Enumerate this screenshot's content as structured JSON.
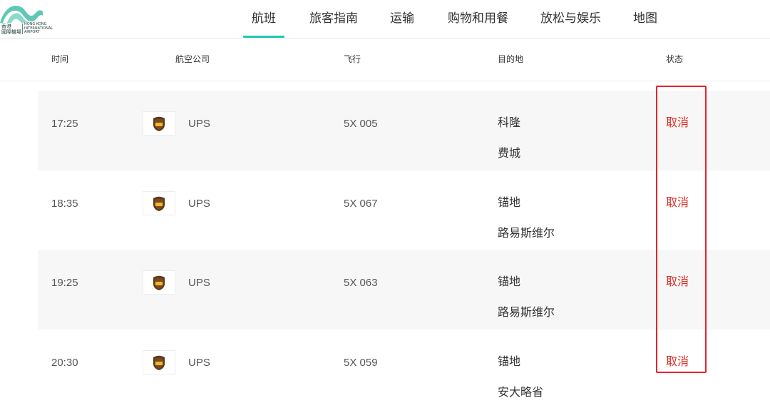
{
  "logo": {
    "zh_line1": "香港",
    "zh_line2": "國際機場",
    "en_line1": "HONG KONG",
    "en_line2": "INTERNATIONAL",
    "en_line3": "AIRPORT",
    "brand_color": "#5fc8b5"
  },
  "nav": {
    "items": [
      {
        "label": "航班",
        "active": true
      },
      {
        "label": "旅客指南",
        "active": false
      },
      {
        "label": "运输",
        "active": false
      },
      {
        "label": "购物和用餐",
        "active": false
      },
      {
        "label": "放松与娱乐",
        "active": false
      },
      {
        "label": "地图",
        "active": false
      }
    ],
    "active_color": "#1fc6b3"
  },
  "table": {
    "headers": {
      "time": "时间",
      "airline": "航空公司",
      "flight": "飞行",
      "destination": "目的地",
      "status": "状态"
    },
    "rows": [
      {
        "time": "17:25",
        "airline": "UPS",
        "airline_icon": "ups-logo-icon",
        "flight": "5X 005",
        "destinations": [
          "科隆",
          "费城"
        ],
        "status": "取消"
      },
      {
        "time": "18:35",
        "airline": "UPS",
        "airline_icon": "ups-logo-icon",
        "flight": "5X 067",
        "destinations": [
          "锚地",
          "路易斯维尔"
        ],
        "status": "取消"
      },
      {
        "time": "19:25",
        "airline": "UPS",
        "airline_icon": "ups-logo-icon",
        "flight": "5X 063",
        "destinations": [
          "锚地",
          "路易斯维尔"
        ],
        "status": "取消"
      },
      {
        "time": "20:30",
        "airline": "UPS",
        "airline_icon": "ups-logo-icon",
        "flight": "5X 059",
        "destinations": [
          "锚地",
          "安大略省"
        ],
        "status": "取消"
      }
    ],
    "status_color": "#e02b22",
    "alt_row_color": "#f7f7f7"
  },
  "annotation": {
    "color": "#e4232b"
  }
}
